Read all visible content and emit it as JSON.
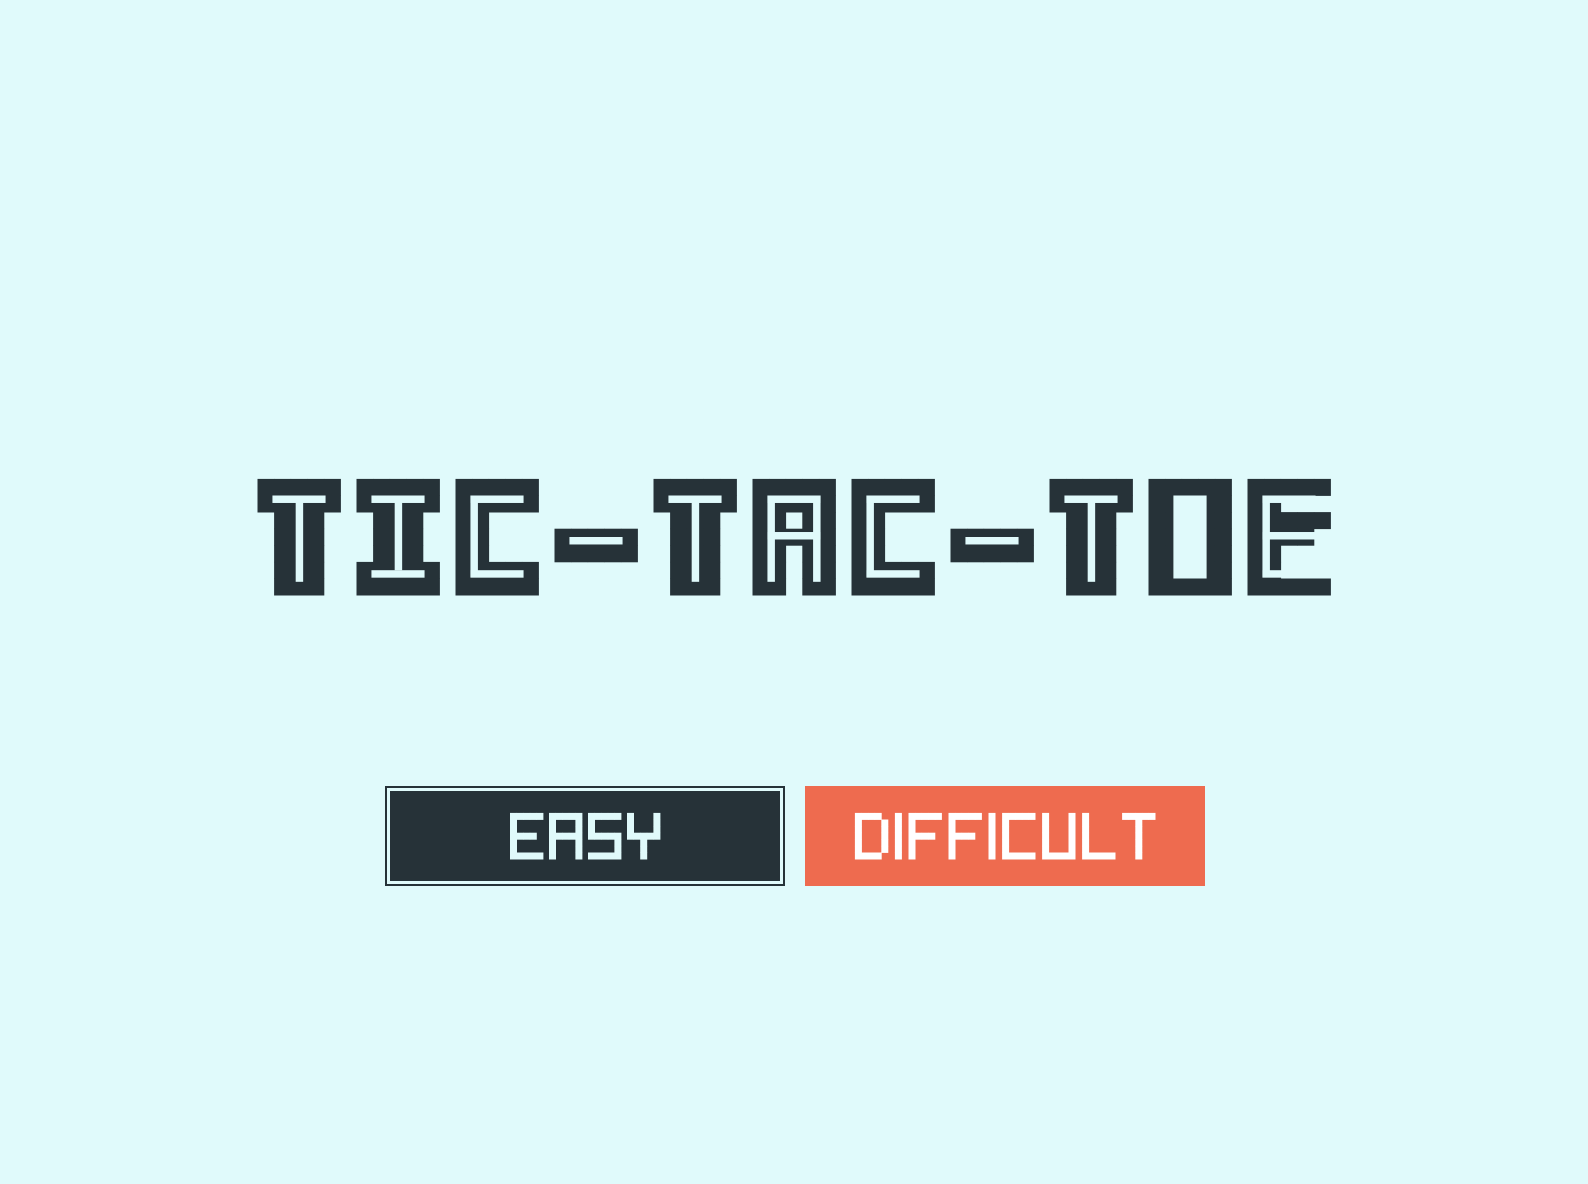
{
  "title": "TIC-TAC-TOE",
  "buttons": {
    "easy_label": "EASY",
    "difficult_label": "DIFFICULT"
  },
  "colors": {
    "background": "#e0fafb",
    "ink": "#263238",
    "accent": "#ee6b4f",
    "button_text": "#e0fafb",
    "difficult_text": "#ffffff"
  },
  "selected_difficulty": "EASY"
}
